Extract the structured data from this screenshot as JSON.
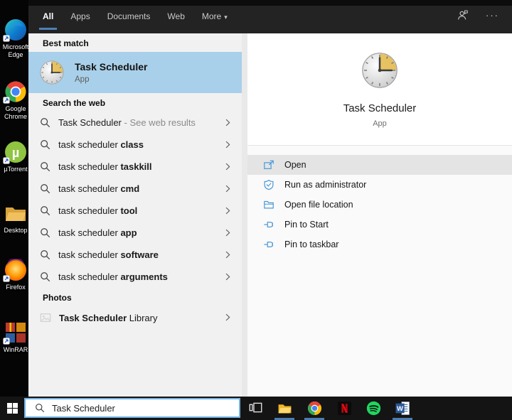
{
  "header": {
    "tabs": [
      {
        "label": "All",
        "active": true
      },
      {
        "label": "Apps",
        "active": false
      },
      {
        "label": "Documents",
        "active": false
      },
      {
        "label": "Web",
        "active": false
      },
      {
        "label": "More",
        "active": false
      }
    ],
    "more_arrow": "▾",
    "ellipsis": "···",
    "icons": [
      "user-account-icon",
      "options-ellipsis"
    ]
  },
  "left_panel": {
    "best_match": {
      "header": "Best match",
      "title": "Task Scheduler",
      "subtitle": "App",
      "icon": "task-scheduler-clock-icon"
    },
    "search_web": {
      "header": "Search the web",
      "items": [
        {
          "normal": "Task Scheduler",
          "muted": " - See web results",
          "bold": ""
        },
        {
          "normal": "task scheduler ",
          "bold": "class",
          "muted": ""
        },
        {
          "normal": "task scheduler ",
          "bold": "taskkill",
          "muted": ""
        },
        {
          "normal": "task scheduler ",
          "bold": "cmd",
          "muted": ""
        },
        {
          "normal": "task scheduler ",
          "bold": "tool",
          "muted": ""
        },
        {
          "normal": "task scheduler ",
          "bold": "app",
          "muted": ""
        },
        {
          "normal": "task scheduler ",
          "bold": "software",
          "muted": ""
        },
        {
          "normal": "task scheduler ",
          "bold": "arguments",
          "muted": ""
        }
      ]
    },
    "photos": {
      "header": "Photos",
      "item": {
        "bold": "Task Scheduler",
        "normal": " Library"
      }
    }
  },
  "right_panel": {
    "title": "Task Scheduler",
    "subtitle": "App",
    "icon": "task-scheduler-clock-icon",
    "actions": [
      {
        "label": "Open",
        "icon": "open-window-icon",
        "highlighted": true
      },
      {
        "label": "Run as administrator",
        "icon": "admin-shield-icon",
        "highlighted": false
      },
      {
        "label": "Open file location",
        "icon": "folder-location-icon",
        "highlighted": false
      },
      {
        "label": "Pin to Start",
        "icon": "pin-icon",
        "highlighted": false
      },
      {
        "label": "Pin to taskbar",
        "icon": "pin-icon",
        "highlighted": false
      }
    ]
  },
  "taskbar": {
    "search": {
      "value": "Task Scheduler",
      "icon": "search-icon"
    },
    "apps": [
      "Task View",
      "File Explorer",
      "Google Chrome",
      "Netflix",
      "Spotify",
      "Microsoft Word"
    ],
    "active_apps": [
      "File Explorer",
      "Google Chrome",
      "Microsoft Word"
    ]
  },
  "desktop": {
    "icons": [
      {
        "label": "Microsoft Edge"
      },
      {
        "label": "Google Chrome"
      },
      {
        "label": "µTorrent"
      },
      {
        "label": "Desktop"
      },
      {
        "label": "Firefox"
      },
      {
        "label": "WinRAR"
      }
    ]
  },
  "colors": {
    "accent_blue": "#4d7fb8",
    "best_match_highlight": "#a9d0ea",
    "action_icon_blue": "#4f9bd8",
    "taskbar_bg": "#141414",
    "left_panel_bg": "#f1f1f1"
  }
}
